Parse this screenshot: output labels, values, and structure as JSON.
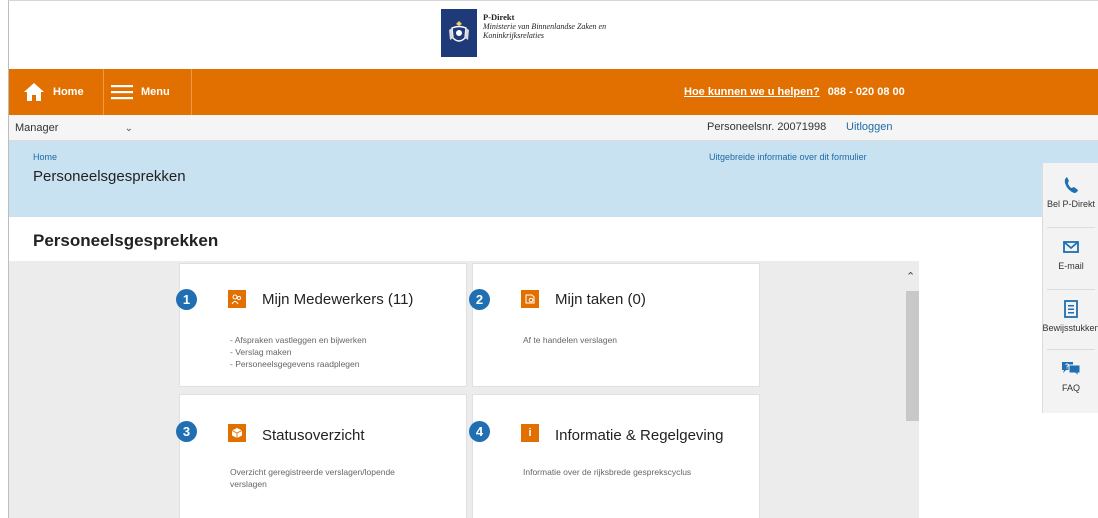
{
  "logo": {
    "brand": "P-Direkt",
    "line1": "Ministerie van Binnenlandse Zaken en",
    "line2": "Koninkrijksrelaties",
    "icon": "coat-of-arms-icon"
  },
  "nav": {
    "home_label": "Home",
    "menu_label": "Menu",
    "help_link": "Hoe kunnen we u helpen?",
    "help_phone": "088 - 020 08 00"
  },
  "role_bar": {
    "role_value": "Manager",
    "employee_nr": "Personeelsnr. 20071998",
    "logout_label": "Uitloggen"
  },
  "banner": {
    "breadcrumb": "Home",
    "title": "Personeelsgesprekken",
    "info_link": "Uitgebreide informatie over dit formulier"
  },
  "main": {
    "title": "Personeelsgesprekken",
    "cards": [
      {
        "number": "1",
        "title": "Mijn Medewerkers (11)",
        "lines": [
          "- Afspraken vastleggen en bijwerken",
          "- Verslag maken",
          "- Personeelsgegevens raadplegen"
        ]
      },
      {
        "number": "2",
        "title": "Mijn taken (0)",
        "lines": [
          "Af te handelen verslagen"
        ]
      },
      {
        "number": "3",
        "title": "Statusoverzicht",
        "lines": [
          "Overzicht geregistreerde verslagen/lopende",
          "verslagen"
        ]
      },
      {
        "number": "4",
        "title": "Informatie & Regelgeving",
        "lines": [
          "Informatie over de rijksbrede gesprekscyclus"
        ]
      }
    ]
  },
  "side_panel": {
    "items": [
      {
        "label": "Bel P-Direkt",
        "icon": "phone-icon"
      },
      {
        "label": "E-mail",
        "icon": "envelope-icon"
      },
      {
        "label": "Bewijsstukken",
        "icon": "document-icon"
      },
      {
        "label": "FAQ",
        "icon": "faq-chat-icon"
      }
    ]
  },
  "colors": {
    "orange": "#e17000",
    "banner_blue": "#c9e2f1",
    "badge_blue": "#1f6fb2",
    "link_blue": "#1f6aa5"
  }
}
